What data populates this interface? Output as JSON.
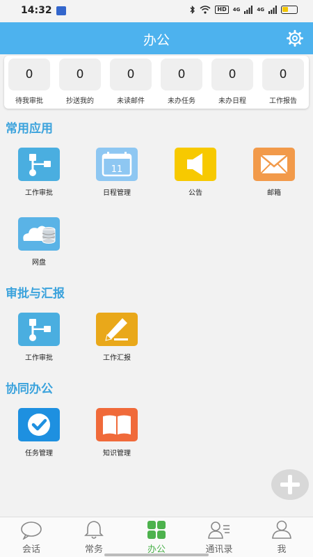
{
  "status_bar": {
    "time": "14:32",
    "hd_label": "HD",
    "net1": "4G",
    "net2": "4G"
  },
  "header": {
    "title": "办公"
  },
  "stats": [
    {
      "value": "0",
      "label": "待我审批"
    },
    {
      "value": "0",
      "label": "抄送我的"
    },
    {
      "value": "0",
      "label": "未读邮件"
    },
    {
      "value": "0",
      "label": "未办任务"
    },
    {
      "value": "0",
      "label": "未办日程"
    },
    {
      "value": "0",
      "label": "工作报告"
    }
  ],
  "sections": {
    "common": {
      "title": "常用应用",
      "apps": [
        {
          "label": "工作审批",
          "icon": "workflow-icon"
        },
        {
          "label": "日程管理",
          "icon": "calendar-icon",
          "day": "11"
        },
        {
          "label": "公告",
          "icon": "megaphone-icon"
        },
        {
          "label": "邮箱",
          "icon": "envelope-icon"
        },
        {
          "label": "网盘",
          "icon": "cloud-storage-icon"
        }
      ]
    },
    "approval": {
      "title": "审批与汇报",
      "apps": [
        {
          "label": "工作审批",
          "icon": "workflow-icon"
        },
        {
          "label": "工作汇报",
          "icon": "pencil-icon"
        }
      ]
    },
    "collab": {
      "title": "协同办公",
      "apps": [
        {
          "label": "任务管理",
          "icon": "checkmark-icon"
        },
        {
          "label": "知识管理",
          "icon": "book-icon"
        }
      ]
    }
  },
  "bottom_nav": [
    {
      "label": "会话",
      "icon": "chat-icon"
    },
    {
      "label": "常务",
      "icon": "bell-icon"
    },
    {
      "label": "办公",
      "icon": "grid-icon",
      "active": true
    },
    {
      "label": "通讯录",
      "icon": "contacts-icon"
    },
    {
      "label": "我",
      "icon": "person-icon"
    }
  ],
  "colors": {
    "header": "#4db2ee",
    "section_title": "#3aa2dc",
    "active_nav": "#4db24d",
    "workflow": "#4aaee0",
    "calendar": "#8ec7f2",
    "megaphone": "#f7c900",
    "envelope": "#f29a4a",
    "cloud": "#5ab3e6",
    "pencil": "#e9a81a",
    "checkmark": "#1e90e0",
    "book": "#f06a3a"
  }
}
